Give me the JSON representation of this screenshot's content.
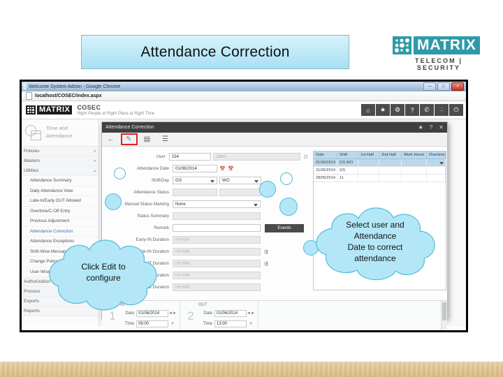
{
  "slide": {
    "title": "Attendance Correction",
    "logo": {
      "word": "MATRIX",
      "tagline": "TELECOM | SECURITY"
    }
  },
  "callouts": [
    {
      "id": "left",
      "text": "Click Edit to\nconfigure"
    },
    {
      "id": "right",
      "text": "Select user and\nAttendance\nDate to correct\nattendance"
    }
  ],
  "callout_left": {
    "line1": "Click Edit to",
    "line2": "configure"
  },
  "callout_right": {
    "line1": "Select user and",
    "line2": "Attendance",
    "line3": "Date to correct",
    "line4": "attendance"
  },
  "browser": {
    "window_title": "Welcome System Admin - Google Chrome",
    "url": "localhost/COSEC/index.aspx",
    "controls": {
      "minimize": "—",
      "maximize": "□",
      "close": "×"
    }
  },
  "cosec": {
    "brand": "MATRIX",
    "product": "COSEC",
    "tagline": "Right People at Right Place at Right Time",
    "nav": [
      {
        "name": "home-icon",
        "glyph": "⌂"
      },
      {
        "name": "star-icon",
        "glyph": "★"
      },
      {
        "name": "gear-icon",
        "glyph": "⚙"
      },
      {
        "name": "help-icon",
        "glyph": "?"
      },
      {
        "name": "phone-icon",
        "glyph": "✆"
      },
      {
        "name": "network-icon",
        "glyph": "∴"
      },
      {
        "name": "power-icon",
        "glyph": "⏻"
      }
    ]
  },
  "sidebar": {
    "module_line1": "Time and",
    "module_line2": "Attendance",
    "groups": [
      {
        "label": "Policies",
        "caret": "▾"
      },
      {
        "label": "Masters",
        "caret": "▾"
      },
      {
        "label": "Utilities",
        "caret": "▴"
      }
    ],
    "items": [
      {
        "label": "Attendance Summary",
        "active": false
      },
      {
        "label": "Daily Attendance View",
        "active": false
      },
      {
        "label": "Late-In/Early OUT Allowed",
        "active": false
      },
      {
        "label": "Overtime/C-Off Entry",
        "active": false
      },
      {
        "label": "Previous Adjustment",
        "active": false
      },
      {
        "label": "Attendance Correction",
        "active": true
      },
      {
        "label": "Attendance Exceptions",
        "active": false
      },
      {
        "label": "Shift-Wise Messages",
        "active": false
      },
      {
        "label": "Change Policy",
        "active": false
      },
      {
        "label": "User-Wise Attendance",
        "active": false
      }
    ],
    "tail_groups": [
      {
        "label": "Authorization"
      },
      {
        "label": "Process"
      },
      {
        "label": "Exports"
      },
      {
        "label": "Reports"
      }
    ]
  },
  "dialog": {
    "title": "Attendance Correction",
    "controls": {
      "favorite": "★",
      "help": "?",
      "close": "✕"
    },
    "toolbar": [
      {
        "name": "back-icon",
        "glyph": "←",
        "highlighted": false
      },
      {
        "name": "edit-icon",
        "glyph": "✎",
        "highlighted": true
      },
      {
        "name": "save-icon",
        "glyph": "▤",
        "highlighted": false
      },
      {
        "name": "report-icon",
        "glyph": "☰",
        "highlighted": false
      }
    ],
    "fields": {
      "user_label": "User",
      "user_id": "234",
      "user_name": "John",
      "date_label": "Attendance Date",
      "date_value": "01/06/2014",
      "shift_label": "Shift/Day",
      "shift_value": "GS",
      "day_value": "WO",
      "status_label": "Attendance Status",
      "status_value": "",
      "status_value2": "",
      "manual_label": "Manual Status Marking",
      "manual_value": "None",
      "summary_label": "Status Summary",
      "summary_value": "",
      "remark_label": "Remark",
      "remark_value": "",
      "events_button": "Events",
      "durations": [
        {
          "label": "Early-IN Duration",
          "value": "HH:MM",
          "link": false
        },
        {
          "label": "Late-IN Duration",
          "value": "HH:MM",
          "link": true
        },
        {
          "label": "Early-OUT Duration",
          "value": "HH:MM",
          "link": true
        },
        {
          "label": "Working Duration",
          "value": "HH:MM",
          "link": false
        },
        {
          "label": "Break Duration",
          "value": "HH:MM",
          "link": false
        }
      ]
    },
    "grid": {
      "columns": [
        "Date",
        "Shift",
        "1st Half",
        "2nd Half",
        "Work Hours",
        "Overtime"
      ],
      "rows": [
        {
          "cells": [
            "01/06/2014",
            "GS   WO",
            "",
            "",
            "",
            ""
          ],
          "selected": true
        },
        {
          "cells": [
            "31/05/2014",
            "GS",
            "",
            "",
            "",
            ""
          ],
          "selected": false
        },
        {
          "cells": [
            "28/05/2014",
            "11",
            "",
            "",
            "",
            ""
          ],
          "selected": false
        }
      ]
    },
    "inout": {
      "in_header": "IN",
      "out_header": "OUT",
      "in_number": "1",
      "out_number": "2",
      "date_label": "Date",
      "time_label": "Time",
      "in_date": "01/06/2014",
      "in_time": "08:00",
      "out_date": "01/06/2014",
      "out_time": "13:00",
      "stepper": "◄►",
      "clear": "✕"
    }
  }
}
